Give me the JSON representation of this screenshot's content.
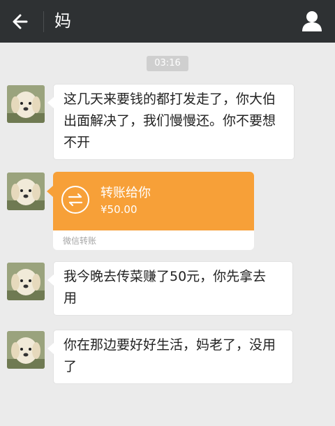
{
  "header": {
    "title": "妈",
    "back_icon": "back-arrow-icon",
    "profile_icon": "person-icon"
  },
  "chat": {
    "timestamp": "03:16",
    "messages": [
      {
        "type": "text",
        "lines": [
          "这几天来要钱的都打发走了，你大伯",
          "出面解决了，我们慢慢还。你不要想",
          "不开"
        ]
      },
      {
        "type": "transfer",
        "title": "转账给你",
        "amount": "¥50.00",
        "label": "微信转账"
      },
      {
        "type": "text",
        "lines": [
          "我今晚去传菜赚了50元，你先拿去",
          "用"
        ]
      },
      {
        "type": "text",
        "lines": [
          "你在那边要好好生活，妈老了，没用",
          "了"
        ]
      }
    ]
  },
  "colors": {
    "header_bg": "#2e3133",
    "chat_bg": "#ebebeb",
    "transfer_orange": "#f7a038"
  }
}
